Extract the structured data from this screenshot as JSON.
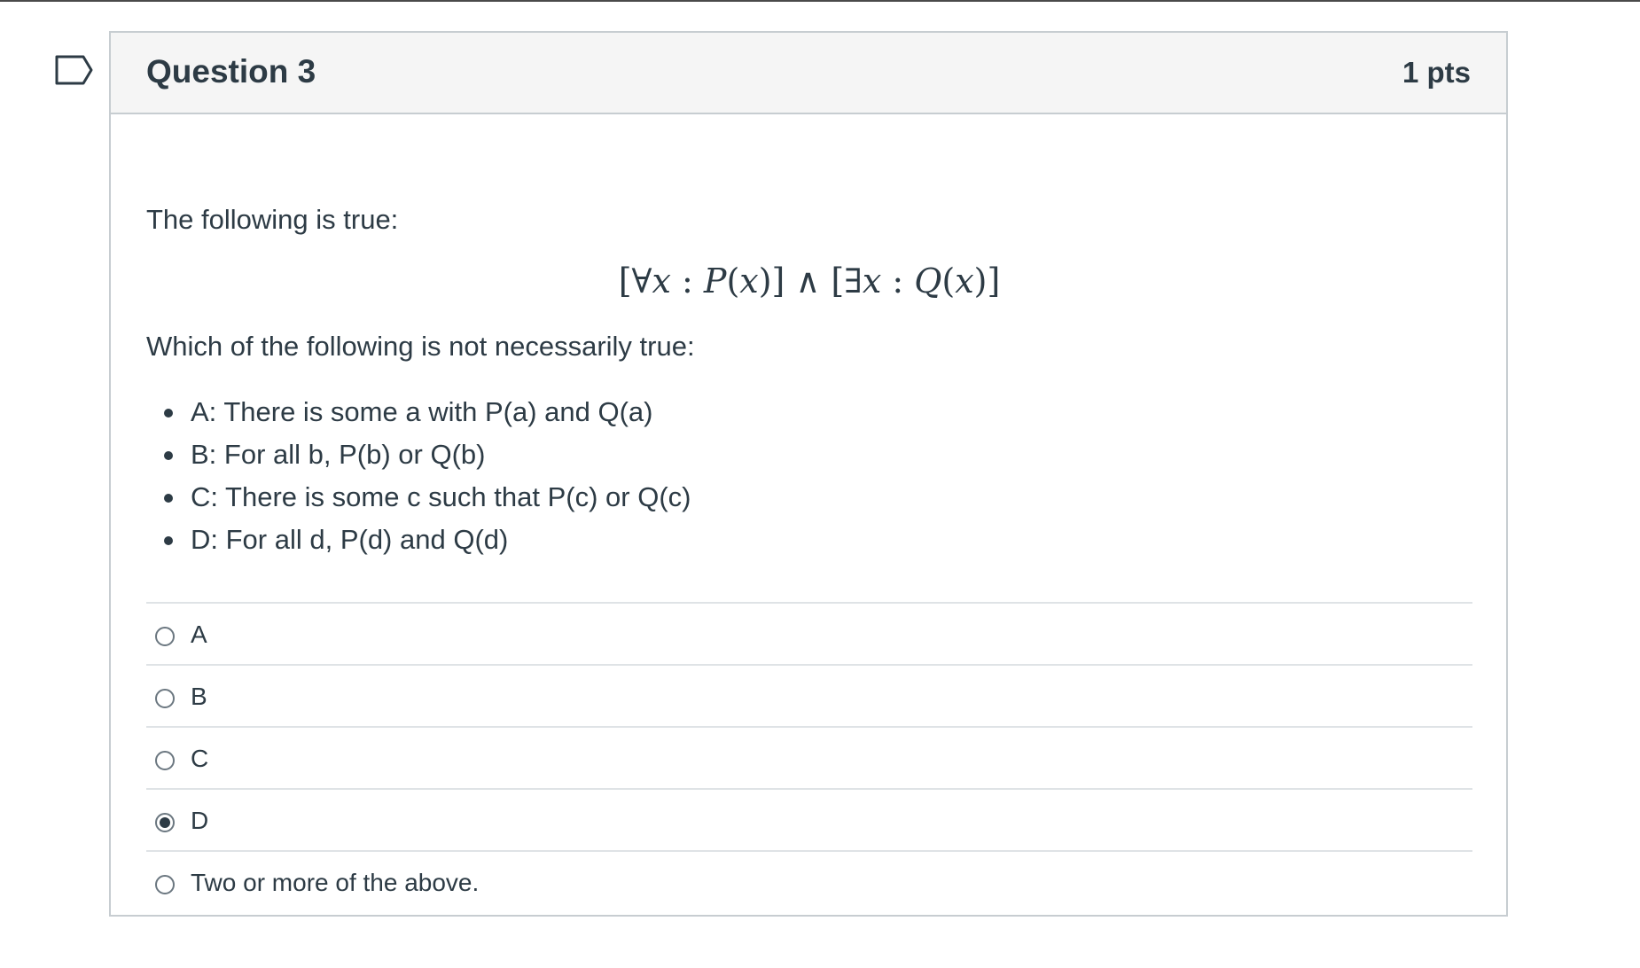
{
  "question": {
    "title": "Question 3",
    "points": "1 pts",
    "flag_icon": "flag-outline-icon"
  },
  "body": {
    "intro": "The following is true:",
    "formula": {
      "lb1": "[",
      "forall": "∀",
      "x1": "x",
      "colon1": " : ",
      "P": "P",
      "paren1": "(",
      "x2": "x",
      "paren2": ")",
      "rb1": "]",
      "and": " ∧ ",
      "lb2": "[",
      "exists": "∃",
      "x3": "x",
      "colon2": " : ",
      "Q": "Q",
      "paren3": "(",
      "x4": "x",
      "paren4": ")",
      "rb2": "]"
    },
    "prompt": "Which of the following is not necessarily true:",
    "statements": [
      "A: There is some a with P(a) and Q(a)",
      "B: For all b, P(b) or Q(b)",
      "C: There is some c such that P(c) or Q(c)",
      "D: For all d, P(d) and Q(d)"
    ]
  },
  "answers": {
    "options": [
      {
        "label": "A",
        "selected": false
      },
      {
        "label": "B",
        "selected": false
      },
      {
        "label": "C",
        "selected": false
      },
      {
        "label": "D",
        "selected": true
      },
      {
        "label": "Two or more of the above.",
        "selected": false
      }
    ]
  },
  "colors": {
    "text": "#2d3b45",
    "header_bg": "#f5f5f5",
    "border": "#c7cdd1",
    "divider": "#dfe3e6"
  }
}
